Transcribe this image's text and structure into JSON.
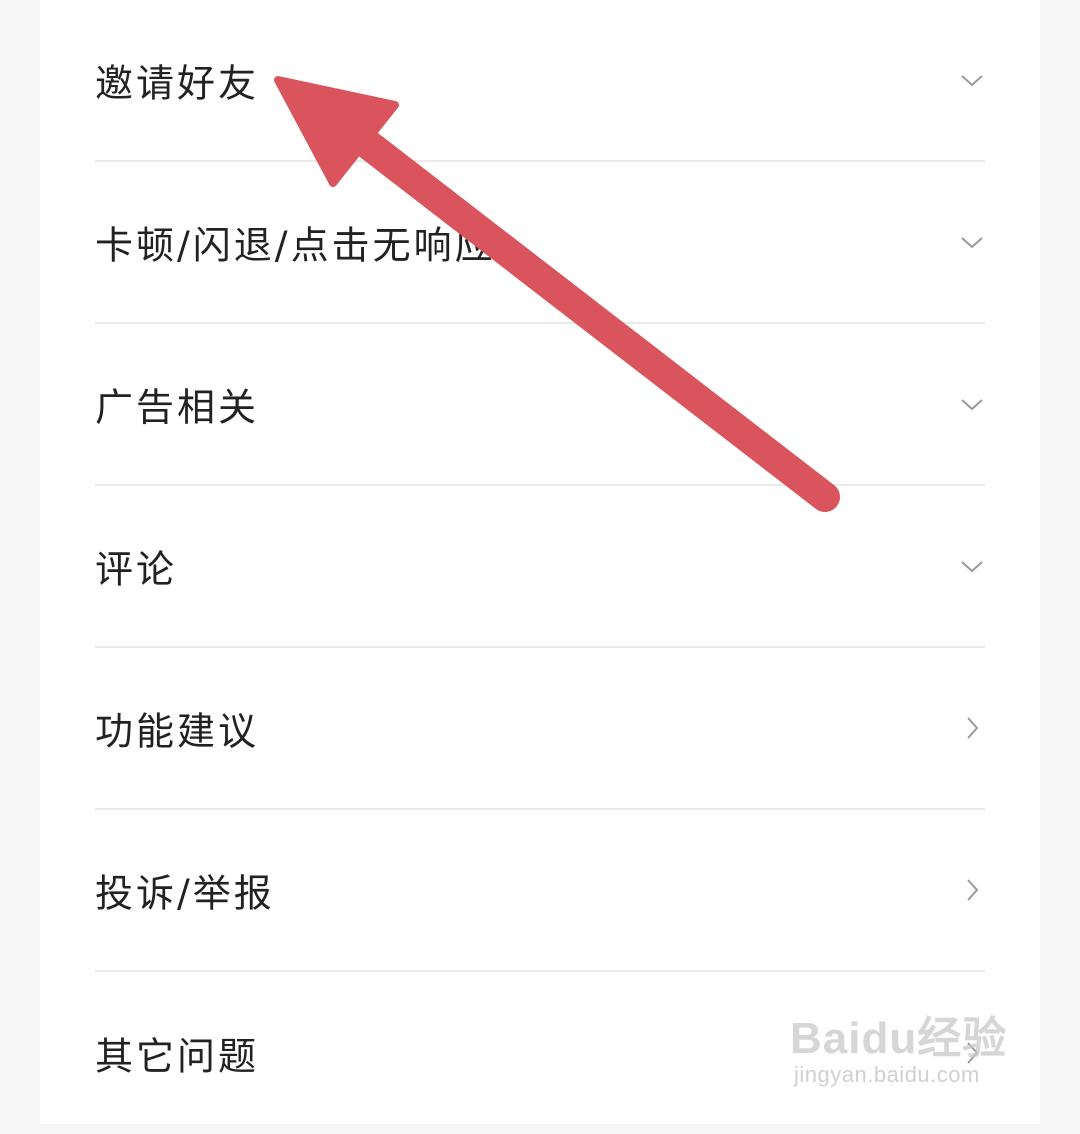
{
  "help_list": {
    "items": [
      {
        "label": "邀请好友",
        "chevron": "chevron-down-icon"
      },
      {
        "label": "卡顿/闪退/点击无响应",
        "chevron": "chevron-down-icon"
      },
      {
        "label": "广告相关",
        "chevron": "chevron-down-icon"
      },
      {
        "label": "评论",
        "chevron": "chevron-down-icon"
      },
      {
        "label": "功能建议",
        "chevron": "chevron-right-icon"
      },
      {
        "label": "投诉/举报",
        "chevron": "chevron-right-icon"
      },
      {
        "label": "其它问题",
        "chevron": "chevron-right-icon"
      }
    ]
  },
  "annotation": {
    "type": "red-arrow",
    "color": "#d9545c"
  },
  "watermark": {
    "logo": "Baidu经验",
    "url": "jingyan.baidu.com"
  }
}
